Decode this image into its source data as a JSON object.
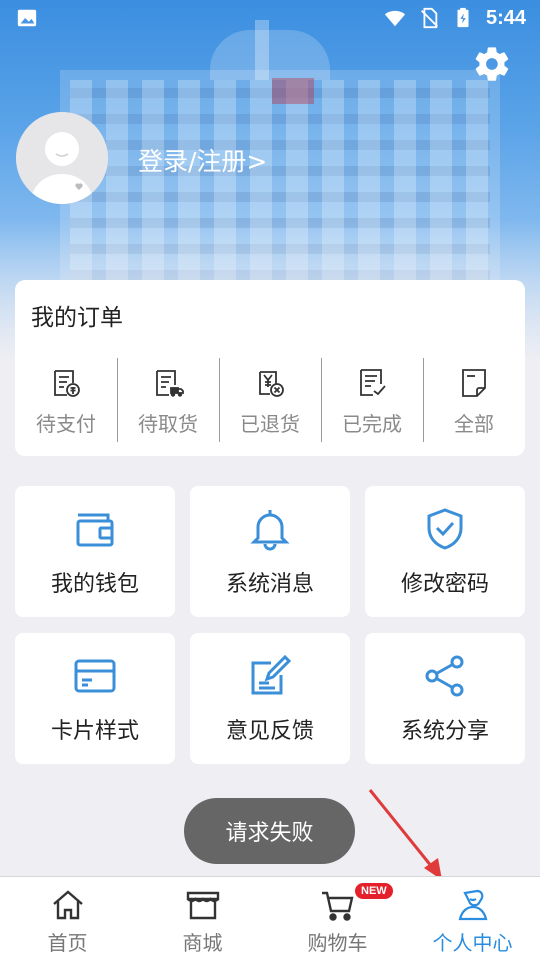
{
  "status_bar": {
    "time": "5:44",
    "icons": [
      "image-icon",
      "wifi-icon",
      "no-sim-icon",
      "battery-charging-icon"
    ]
  },
  "header": {
    "settings_icon": "gear-icon",
    "login_text": "登录/注册>",
    "avatar_icon": "default-avatar"
  },
  "orders": {
    "title": "我的订单",
    "items": [
      {
        "label": "待支付",
        "icon": "pending-payment-icon"
      },
      {
        "label": "待取货",
        "icon": "pending-pickup-icon"
      },
      {
        "label": "已退货",
        "icon": "returned-icon"
      },
      {
        "label": "已完成",
        "icon": "completed-icon"
      },
      {
        "label": "全部",
        "icon": "all-orders-icon"
      }
    ]
  },
  "features": [
    {
      "label": "我的钱包",
      "icon": "wallet-icon"
    },
    {
      "label": "系统消息",
      "icon": "bell-icon"
    },
    {
      "label": "修改密码",
      "icon": "shield-check-icon"
    },
    {
      "label": "卡片样式",
      "icon": "card-icon"
    },
    {
      "label": "意见反馈",
      "icon": "edit-icon"
    },
    {
      "label": "系统分享",
      "icon": "share-icon"
    }
  ],
  "toast": {
    "text": "请求失败"
  },
  "bottom_nav": {
    "items": [
      {
        "label": "首页",
        "icon": "home-icon",
        "active": false
      },
      {
        "label": "商城",
        "icon": "store-icon",
        "active": false,
        "badge": "NEW"
      },
      {
        "label": "购物车",
        "icon": "cart-icon",
        "active": false
      },
      {
        "label": "个人中心",
        "icon": "profile-icon",
        "active": true
      }
    ]
  },
  "colors": {
    "accent": "#2b8de0",
    "icon_blue": "#3a8fd8",
    "badge_red": "#e4202a",
    "arrow_red": "#e03a3a"
  }
}
